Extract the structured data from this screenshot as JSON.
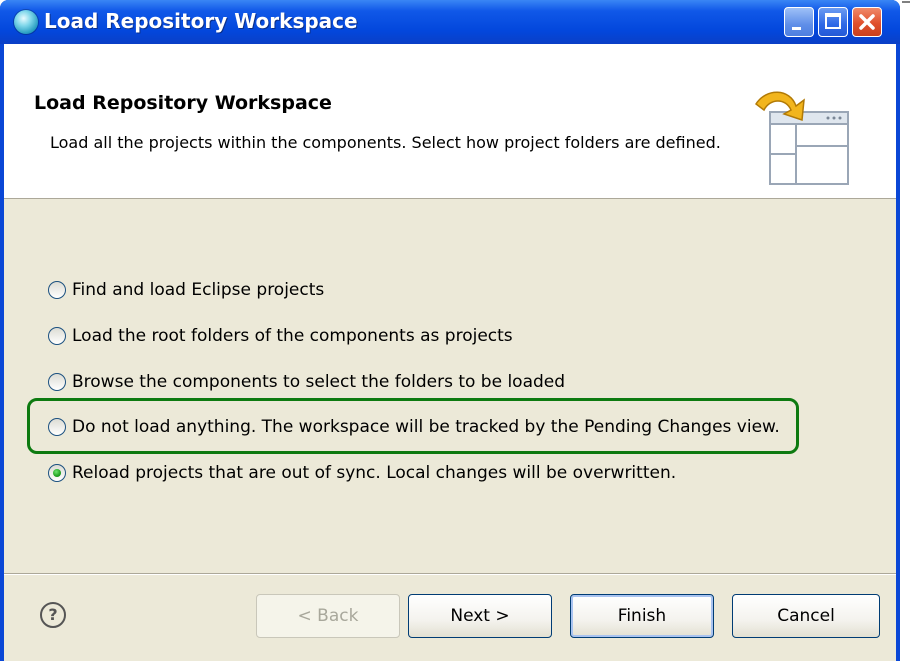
{
  "window": {
    "title": "Load Repository Workspace",
    "controls": {
      "minimize": "minimize",
      "maximize": "maximize",
      "close": "close"
    }
  },
  "header": {
    "title": "Load Repository Workspace",
    "description": "Load all the projects within the components. Select how project folders are defined.",
    "icon": "wizard-load-icon"
  },
  "options": [
    {
      "label": "Find and load Eclipse projects",
      "selected": false
    },
    {
      "label": "Load the root folders of the components as projects",
      "selected": false
    },
    {
      "label": "Browse the components to select the folders to be loaded",
      "selected": false
    },
    {
      "label": "Do not load anything. The workspace will be tracked by the Pending Changes view.",
      "selected": false
    },
    {
      "label": "Reload projects that are out of sync. Local changes will be overwritten.",
      "selected": true
    }
  ],
  "buttons": {
    "help": "?",
    "back": "< Back",
    "next": "Next >",
    "finish": "Finish",
    "cancel": "Cancel"
  },
  "colors": {
    "titlebar": "#0a47d6",
    "highlight": "#0d7a10",
    "dialog_bg": "#ece9d8"
  }
}
